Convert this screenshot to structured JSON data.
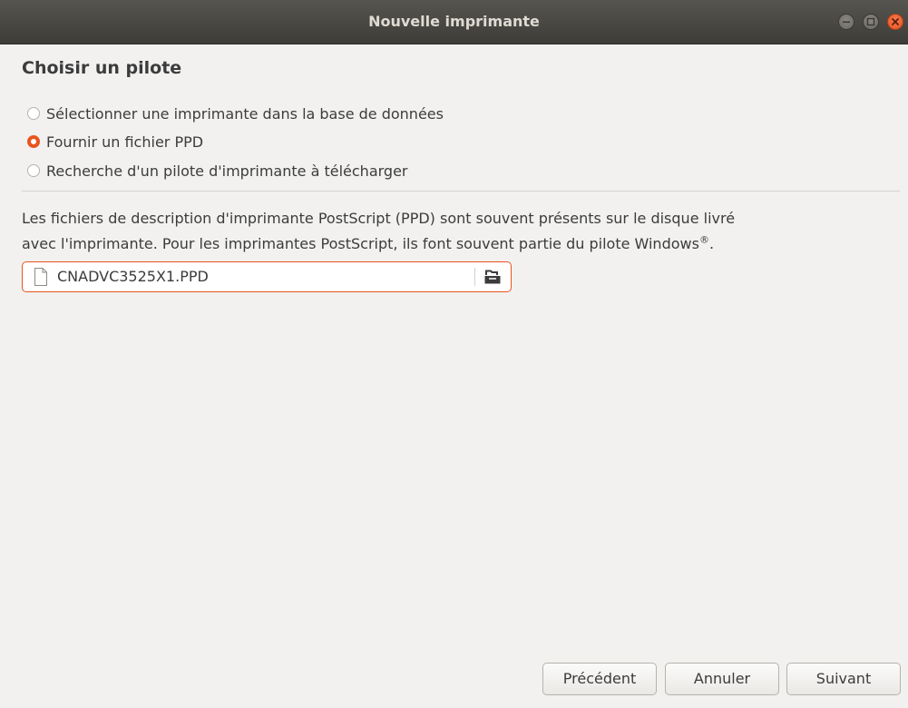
{
  "window": {
    "title": "Nouvelle imprimante",
    "controls": [
      "minimize",
      "maximize",
      "close"
    ]
  },
  "heading": "Choisir un pilote",
  "options": [
    {
      "label": "Sélectionner une imprimante dans la base de données",
      "checked": false
    },
    {
      "label": "Fournir un fichier PPD",
      "checked": true
    },
    {
      "label": "Recherche d'un pilote d'imprimante à télécharger",
      "checked": false
    }
  ],
  "description": {
    "line1": "Les fichiers de description d'imprimante PostScript (PPD) sont souvent présents sur le disque livré",
    "line2": "avec l'imprimante. Pour les imprimantes PostScript, ils font souvent partie du pilote Windows",
    "mark": "®",
    "end": "."
  },
  "file_chooser": {
    "value": "CNADVC3525X1.PPD",
    "file_icon": "document-icon",
    "open_icon": "folder-open-icon"
  },
  "buttons": {
    "previous": "Précédent",
    "cancel": "Annuler",
    "next": "Suivant"
  },
  "colors": {
    "accent": "#e95420",
    "titlebar": "#3d3c38",
    "background": "#f2f1f0"
  }
}
